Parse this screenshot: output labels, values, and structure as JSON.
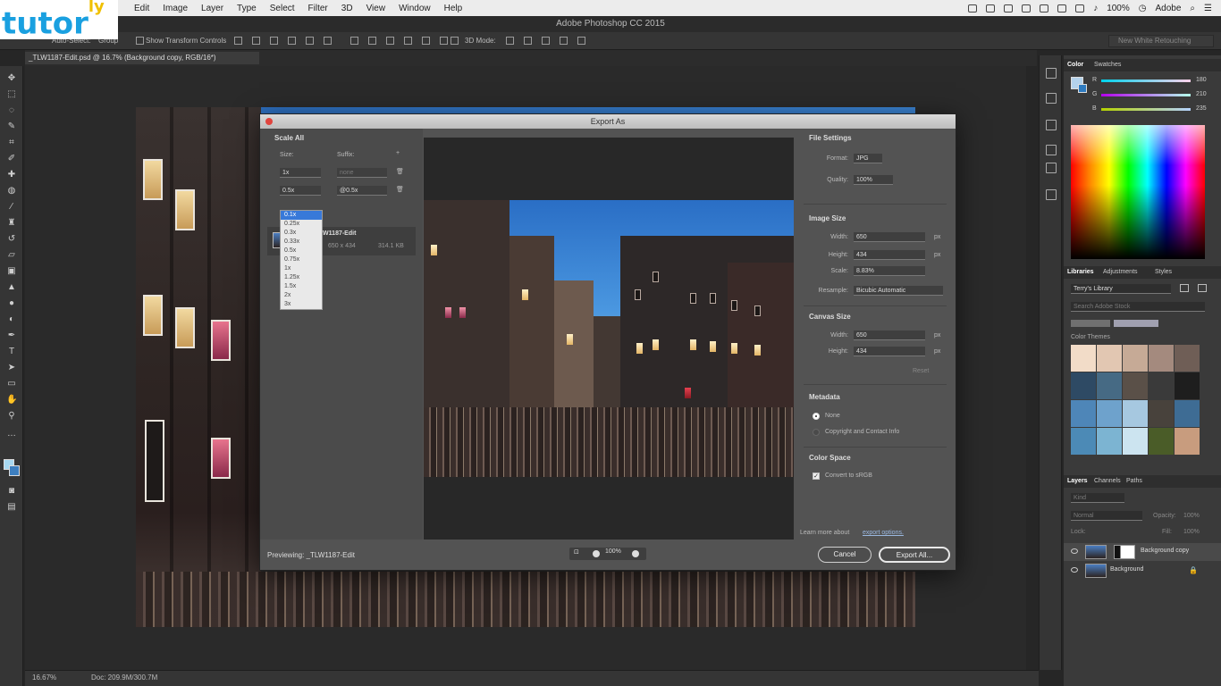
{
  "menubar": {
    "items": [
      "Edit",
      "Image",
      "Layer",
      "Type",
      "Select",
      "Filter",
      "3D",
      "View",
      "Window",
      "Help"
    ],
    "battery": "100%",
    "account": "Adobe"
  },
  "logo": {
    "text": "tutor",
    "suffix": "ly"
  },
  "app": {
    "title": "Adobe Photoshop CC 2015"
  },
  "options_bar": {
    "auto_select": "Auto-Select:",
    "auto_select_value": "Group",
    "show_transform": "Show Transform Controls",
    "mode_3d": "3D Mode:",
    "workspace": "New White Retouching"
  },
  "document": {
    "tab": "_TLW1187-Edit.psd @ 16.7% (Background copy, RGB/16*)"
  },
  "dialog": {
    "title": "Export As",
    "scale_all": {
      "heading": "Scale All",
      "size_label": "Size:",
      "suffix_label": "Suffix:",
      "row1_size": "1x",
      "row1_suffix": "none",
      "row2_size": "0.5x",
      "row2_suffix": "@0.5x",
      "options": [
        "0.1x",
        "0.25x",
        "0.3x",
        "0.33x",
        "0.5x",
        "0.75x",
        "1x",
        "1.25x",
        "1.5x",
        "2x",
        "3x"
      ],
      "selected_option": "0.1x"
    },
    "asset": {
      "name": "_TLW1187-Edit",
      "dimensions": "650 x 434",
      "size": "314.1 KB"
    },
    "file_settings": {
      "heading": "File Settings",
      "format_label": "Format:",
      "format_value": "JPG",
      "quality_label": "Quality:",
      "quality_value": "100%"
    },
    "image_size": {
      "heading": "Image Size",
      "width_label": "Width:",
      "width_value": "650",
      "height_label": "Height:",
      "height_value": "434",
      "scale_label": "Scale:",
      "scale_value": "8.83%",
      "resample_label": "Resample:",
      "resample_value": "Bicubic Automatic",
      "unit": "px"
    },
    "canvas_size": {
      "heading": "Canvas Size",
      "width_label": "Width:",
      "width_value": "650",
      "height_label": "Height:",
      "height_value": "434",
      "reset": "Reset",
      "unit": "px"
    },
    "metadata": {
      "heading": "Metadata",
      "option_none": "None",
      "option_copyright": "Copyright and Contact Info",
      "selected": "None"
    },
    "color_space": {
      "heading": "Color Space",
      "convert": "Convert to sRGB",
      "checked": true
    },
    "learn_more": "Learn more about",
    "learn_more_link": "export options.",
    "previewing": "Previewing: _TLW1187-Edit",
    "zoom": "100%",
    "cancel": "Cancel",
    "export": "Export All..."
  },
  "panels": {
    "color_tabs": [
      "Color",
      "Swatches"
    ],
    "rgb": {
      "r": "180",
      "g": "210",
      "b": "235"
    },
    "libraries_tabs": [
      "Libraries",
      "Adjustments",
      "Styles"
    ],
    "library_name": "Terry's Library",
    "library_search": "Search Adobe Stock",
    "color_themes": "Color Themes",
    "swatches": [
      "#f2dcc8",
      "#e2c7b2",
      "#c6aa96",
      "#a48a7e",
      "#6f5e56",
      "#2e4a64",
      "#466a84",
      "#5a5048",
      "#3a3a3a",
      "#1e1e1e",
      "#4e86b8",
      "#6ea2cc",
      "#a6c8e0",
      "#48423c",
      "#3e6c94",
      "#4c8ab6",
      "#7cb4d2",
      "#cce4f0",
      "#4a5c28",
      "#c89c7e"
    ],
    "layers_tabs": [
      "Layers",
      "Channels",
      "Paths"
    ],
    "kind": "Kind",
    "blend": "Normal",
    "opacity_label": "Opacity:",
    "opacity_value": "100%",
    "lock_label": "Lock:",
    "fill_label": "Fill:",
    "fill_value": "100%",
    "layers": [
      "Background copy",
      "Background"
    ]
  },
  "status": {
    "zoom": "16.67%",
    "doc": "Doc: 209.9M/300.7M"
  }
}
